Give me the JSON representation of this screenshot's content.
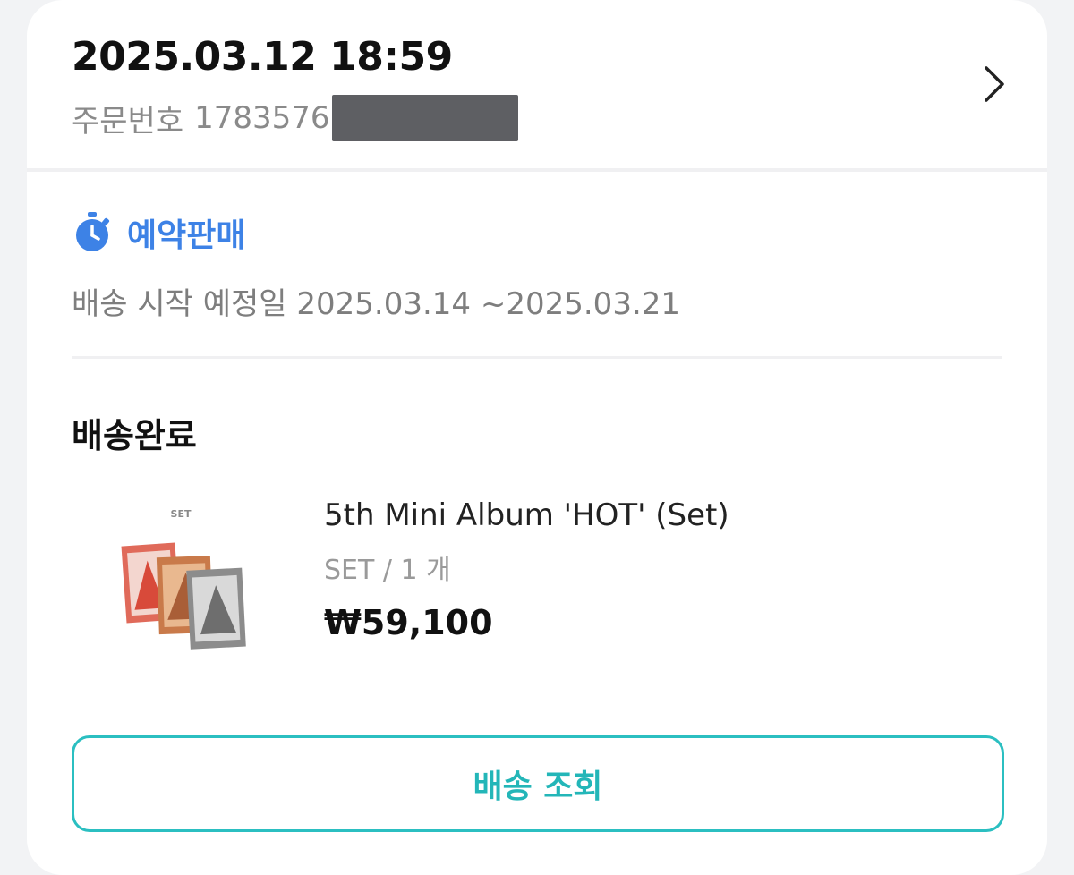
{
  "order": {
    "date_time": "2025.03.12 18:59",
    "number_label": "주문번호",
    "number_visible": "1783576"
  },
  "preorder": {
    "label": "예약판매",
    "ship_schedule": "배송 시작 예정일 2025.03.14 ~2025.03.21"
  },
  "delivery": {
    "status": "배송완료"
  },
  "product": {
    "thumbnail_text": "SET",
    "name": "5th Mini Album 'HOT' (Set)",
    "option": "SET / 1 개",
    "price": "₩59,100"
  },
  "actions": {
    "track_label": "배송 조회"
  },
  "icons": {
    "header_chevron": "chevron-right-icon",
    "preorder": "stopwatch-icon"
  },
  "colors": {
    "accent_blue": "#3d82e6",
    "accent_teal": "#2bbfc1"
  }
}
